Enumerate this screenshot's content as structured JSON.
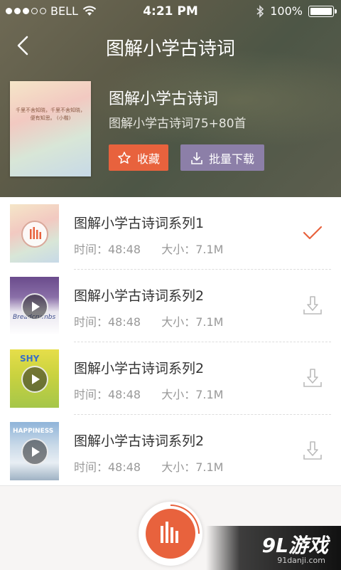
{
  "status": {
    "carrier": "BELL",
    "time": "4:21 PM",
    "battery": "100%"
  },
  "nav": {
    "title": "图解小学古诗词"
  },
  "album": {
    "cover_text": "千里不舍知晓，千里不舍知晓，便有知思。 (小楷)",
    "title": "图解小学古诗词",
    "subtitle": "图解小学古诗词75+80首",
    "fav_label": "收藏",
    "download_label": "批量下载"
  },
  "tracks": [
    {
      "title": "图解小学古诗词系列1",
      "time_label": "时间：48:48",
      "size_label": "大小：7.1M",
      "state": "downloaded",
      "thumb_text": ""
    },
    {
      "title": "图解小学古诗词系列2",
      "time_label": "时间：48:48",
      "size_label": "大小：7.1M",
      "state": "download",
      "thumb_text": "Breadcrumbs"
    },
    {
      "title": "图解小学古诗词系列2",
      "time_label": "时间：48:48",
      "size_label": "大小：7.1M",
      "state": "download",
      "thumb_text": "SHY"
    },
    {
      "title": "图解小学古诗词系列2",
      "time_label": "时间：48:48",
      "size_label": "大小：7.1M",
      "state": "download",
      "thumb_text": "HAPPINESS"
    }
  ],
  "watermark": {
    "main": "9L游戏",
    "sub": "91danji.com"
  },
  "colors": {
    "accent": "#e8623d",
    "download_btn": "#8c7fa8"
  }
}
